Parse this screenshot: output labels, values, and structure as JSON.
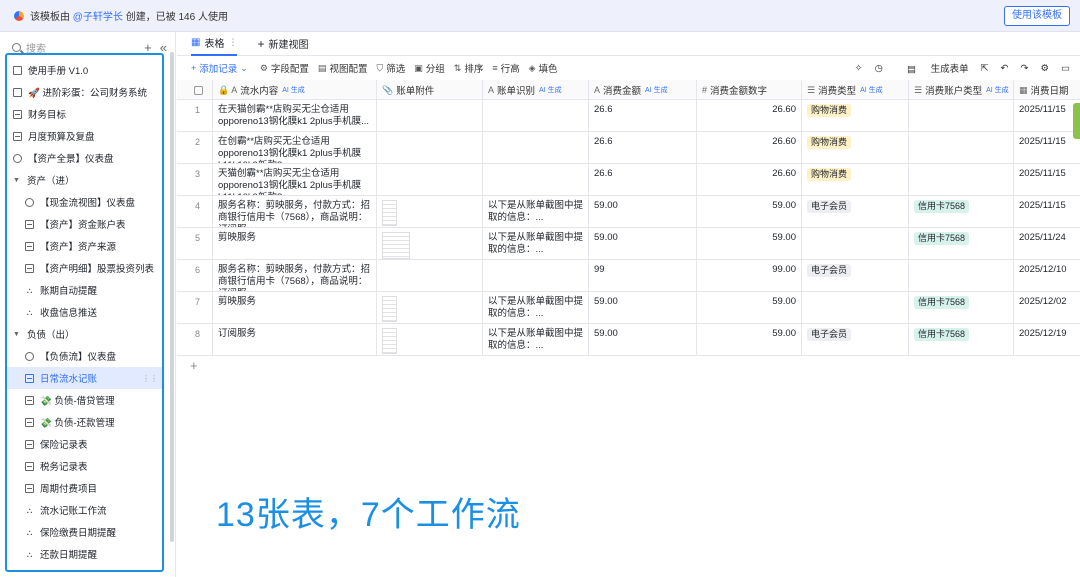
{
  "topbar": {
    "notice_prefix": "该模板由",
    "author": "@子轩学长",
    "notice_suffix": "创建，已被 146 人使用",
    "use_button": "使用该模板"
  },
  "sidebar": {
    "search_placeholder": "搜索",
    "add_icon": "+",
    "collapse_icon": "«",
    "items": [
      {
        "label": "使用手册 V1.0",
        "icon": "doc-icon"
      },
      {
        "label": "🚀 进阶彩蛋：公司财务系统",
        "icon": "doc-icon"
      },
      {
        "label": "财务目标",
        "icon": "grid-icon"
      },
      {
        "label": "月度预算及复盘",
        "icon": "grid-icon"
      },
      {
        "label": "【资产全景】仪表盘",
        "icon": "dashboard-icon"
      },
      {
        "label": "资产（进）",
        "icon": "caret-icon"
      },
      {
        "label": "【现金流视图】仪表盘",
        "icon": "dashboard-icon"
      },
      {
        "label": "【资产】资金账户表",
        "icon": "grid-icon"
      },
      {
        "label": "【资产】资产来源",
        "icon": "grid-icon"
      },
      {
        "label": "【资产明细】股票投资列表",
        "icon": "grid-icon"
      },
      {
        "label": "账期自动提醒",
        "icon": "workflow-icon"
      },
      {
        "label": "收盘信息推送",
        "icon": "workflow-icon"
      },
      {
        "label": "负债（出）",
        "icon": "caret-icon"
      },
      {
        "label": "【负债流】仪表盘",
        "icon": "dashboard-icon"
      },
      {
        "label": "日常流水记账",
        "icon": "grid-icon",
        "active": true
      },
      {
        "label": "💸 负债-借贷管理",
        "icon": "grid-icon"
      },
      {
        "label": "💸 负债-还款管理",
        "icon": "grid-icon"
      },
      {
        "label": "保险记录表",
        "icon": "grid-icon"
      },
      {
        "label": "税务记录表",
        "icon": "grid-icon"
      },
      {
        "label": "周期付费项目",
        "icon": "grid-icon"
      },
      {
        "label": "流水记账工作流",
        "icon": "workflow-icon"
      },
      {
        "label": "保险缴费日期提醒",
        "icon": "workflow-icon"
      },
      {
        "label": "还款日期提醒",
        "icon": "workflow-icon"
      }
    ]
  },
  "tabs": {
    "table_tab": "表格",
    "new_view": "新建视图"
  },
  "toolbar": {
    "add_record": "添加记录",
    "field_config": "字段配置",
    "view_config": "视图配置",
    "filter": "筛选",
    "group": "分组",
    "sort": "排序",
    "row_height": "行高",
    "fill_color": "填色",
    "generate_form": "生成表单"
  },
  "table": {
    "ai_tag": "AI 生成",
    "headers": [
      {
        "label": "流水内容",
        "icon": "A",
        "ai": true
      },
      {
        "label": "账单附件",
        "icon": "📎",
        "ai": false
      },
      {
        "label": "账单识别",
        "icon": "A",
        "ai": true
      },
      {
        "label": "消费金额",
        "icon": "A",
        "ai": true
      },
      {
        "label": "消费金额数字",
        "icon": "#",
        "ai": false
      },
      {
        "label": "消费类型",
        "icon": "☰",
        "ai": true
      },
      {
        "label": "消费账户类型",
        "icon": "☰",
        "ai": true
      },
      {
        "label": "消费日期",
        "icon": "▦",
        "ai": false
      }
    ],
    "rows": [
      {
        "no": "1",
        "content": "在天猫创霸**店购买无尘仓适用opporeno13钢化膜k1 2plus手机膜...",
        "attach": 0,
        "recog": "",
        "amount": "26.6",
        "amount_num": "26.60",
        "type": "购物消费",
        "account": "",
        "date": "2025/11/15"
      },
      {
        "no": "2",
        "content": "在创霸**店购买无尘仓适用opporeno13钢化膜k1 2plus手机膜k11k10k9新款8pro......",
        "attach": 0,
        "recog": "",
        "amount": "26.6",
        "amount_num": "26.60",
        "type": "购物消费",
        "account": "",
        "date": "2025/11/15"
      },
      {
        "no": "3",
        "content": "天猫创霸**店购买无尘仓适用opporeno13钢化膜k1 2plus手机膜k11k10k9新款8pro...",
        "attach": 0,
        "recog": "",
        "amount": "26.6",
        "amount_num": "26.60",
        "type": "购物消费",
        "account": "",
        "date": "2025/11/15"
      },
      {
        "no": "4",
        "content": "服务名称：剪映服务，付款方式：招商银行信用卡（7568），商品说明：订阅服...",
        "attach": 1,
        "recog": "以下是从账单截图中提取的信息：...",
        "amount": "59.00",
        "amount_num": "59.00",
        "type": "电子会员",
        "account": "信用卡7568",
        "date": "2025/11/15"
      },
      {
        "no": "5",
        "content": "剪映服务",
        "attach": 2,
        "recog": "以下是从账单截图中提取的信息：...",
        "amount": "59.00",
        "amount_num": "59.00",
        "type": "",
        "account": "信用卡7568",
        "date": "2025/11/24"
      },
      {
        "no": "6",
        "content": "服务名称：剪映服务，付款方式：招商银行信用卡（7568），商品说明：订阅服...",
        "attach": 0,
        "recog": "",
        "amount": "99",
        "amount_num": "99.00",
        "type": "电子会员",
        "account": "",
        "date": "2025/12/10"
      },
      {
        "no": "7",
        "content": "剪映服务",
        "attach": 1,
        "recog": "以下是从账单截图中提取的信息：...",
        "amount": "59.00",
        "amount_num": "59.00",
        "type": "",
        "account": "信用卡7568",
        "date": "2025/12/02"
      },
      {
        "no": "8",
        "content": "订阅服务",
        "attach": 1,
        "recog": "以下是从账单截图中提取的信息：...",
        "amount": "59.00",
        "amount_num": "59.00",
        "type": "电子会员",
        "account": "信用卡7568",
        "date": "2025/12/19"
      }
    ]
  },
  "colors": {
    "accent": "#3370ff",
    "tag_shopping_bg": "#fdf1c5",
    "tag_member_bg": "#eceef1",
    "tag_card_bg": "#d7f2ea",
    "overlay_blue": "#1a8fe3"
  },
  "overlay_text": "13张表，7个工作流"
}
